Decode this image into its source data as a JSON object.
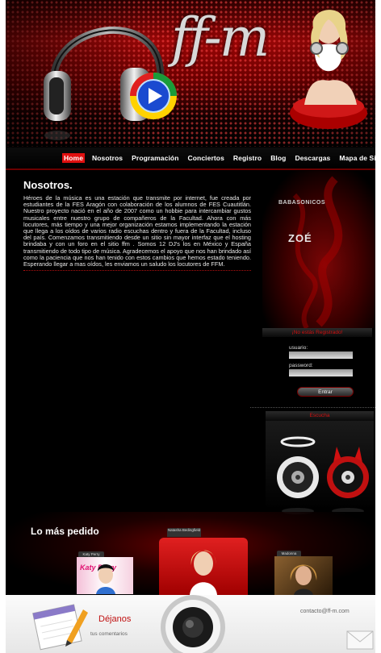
{
  "header": {
    "logo_text": "ff-m"
  },
  "nav": {
    "items": [
      {
        "label": "Home",
        "active": true
      },
      {
        "label": "Nosotros"
      },
      {
        "label": "Programación"
      },
      {
        "label": "Conciertos"
      },
      {
        "label": "Registro"
      },
      {
        "label": "Blog"
      },
      {
        "label": "Descargas"
      },
      {
        "label": "Mapa de Sitio"
      }
    ]
  },
  "about": {
    "title": "Nosotros.",
    "body": "Héroes de la música es una estación que transmite por internet, fue creada por estudiantes de la FES Aragón con colaboración de los alumnos de FES Cuautitlán. Nuestro proyecto nació en el año de 2007 como un hobbie para intercambiar gustos musicales entre nuestro grupo de compañeros de la Facultad. Ahora con más locutores, más tiempo y una mejor organización estamos implementando la estación que llega a los oídos de varios radio escuchas dentro y fuera de la Facultad, incluso del país. Comenzamos transmitiendo desde un sitio sin mayor interfaz que el hosting brindaba y con un foro en el sitio ffm . Somos 12 DJ's los en México y España transmitiendo de todo tipo de música. Agradecemos el apoyo que nos han brindado así como la paciencia que nos han tenido con estos cambios que hemos estado teniendo. Esperando llegar a mas oídos, les enviamos un saludo los locutores de FFM."
  },
  "sidebar": {
    "brand1": "BABASONICOS",
    "brand2": "ZOÉ",
    "login": {
      "title": "¡No estás Registrado!",
      "user_label": "usuario:",
      "pass_label": "password:",
      "button": "Entrar"
    },
    "player_title": "Escucha"
  },
  "lo_mas_pedido": {
    "title": "Lo más pedido",
    "albums": [
      {
        "tag": "Katy Perry",
        "cover_text": "Katy Perry"
      },
      {
        "tag": "Natasha Bedingfield",
        "cover_text": ""
      },
      {
        "tag": "Madonna",
        "cover_text": ""
      }
    ]
  },
  "footer": {
    "title": "Déjanos",
    "subtitle": "tus comentarios",
    "email": "contacto@ff-m.com"
  },
  "colors": {
    "accent": "#e01010",
    "background": "#000000",
    "footer_bg": "#f2f2f2"
  }
}
